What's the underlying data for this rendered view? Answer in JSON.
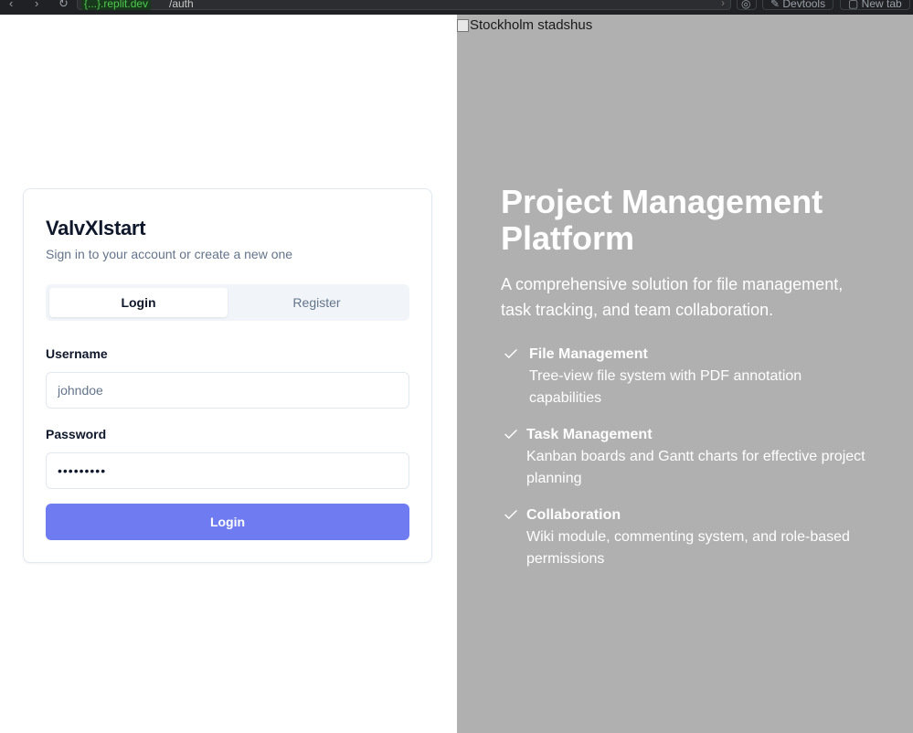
{
  "browser": {
    "url_domain": "{...}.replit.dev",
    "url_path": "/auth",
    "devtools_label": "Devtools",
    "new_tab_label": "New tab"
  },
  "auth": {
    "app_name": "ValvXlstart",
    "subtitle": "Sign in to your account or create a new one",
    "tabs": [
      {
        "label": "Login",
        "active": true
      },
      {
        "label": "Register",
        "active": false
      }
    ],
    "username_label": "Username",
    "username_placeholder": "johndoe",
    "password_label": "Password",
    "password_value": "•••••••••",
    "submit_label": "Login"
  },
  "hero": {
    "image_alt": "Stockholm stadshus",
    "title": "Project Management Platform",
    "description": "A comprehensive solution for file management, task tracking, and team collaboration.",
    "features": [
      {
        "icon": "check-icon",
        "title": "File Management",
        "description": "Tree-view file system with PDF annotation capabilities"
      },
      {
        "icon": "check-icon",
        "title": "Task Management",
        "description": "Kanban boards and Gantt charts for effective project planning"
      },
      {
        "icon": "check-icon",
        "title": "Collaboration",
        "description": "Wiki module, commenting system, and role-based permissions"
      }
    ]
  },
  "colors": {
    "primary_button": "#6f7bf0",
    "hero_background": "#b0b0b0",
    "tab_background": "#f1f5f9"
  }
}
